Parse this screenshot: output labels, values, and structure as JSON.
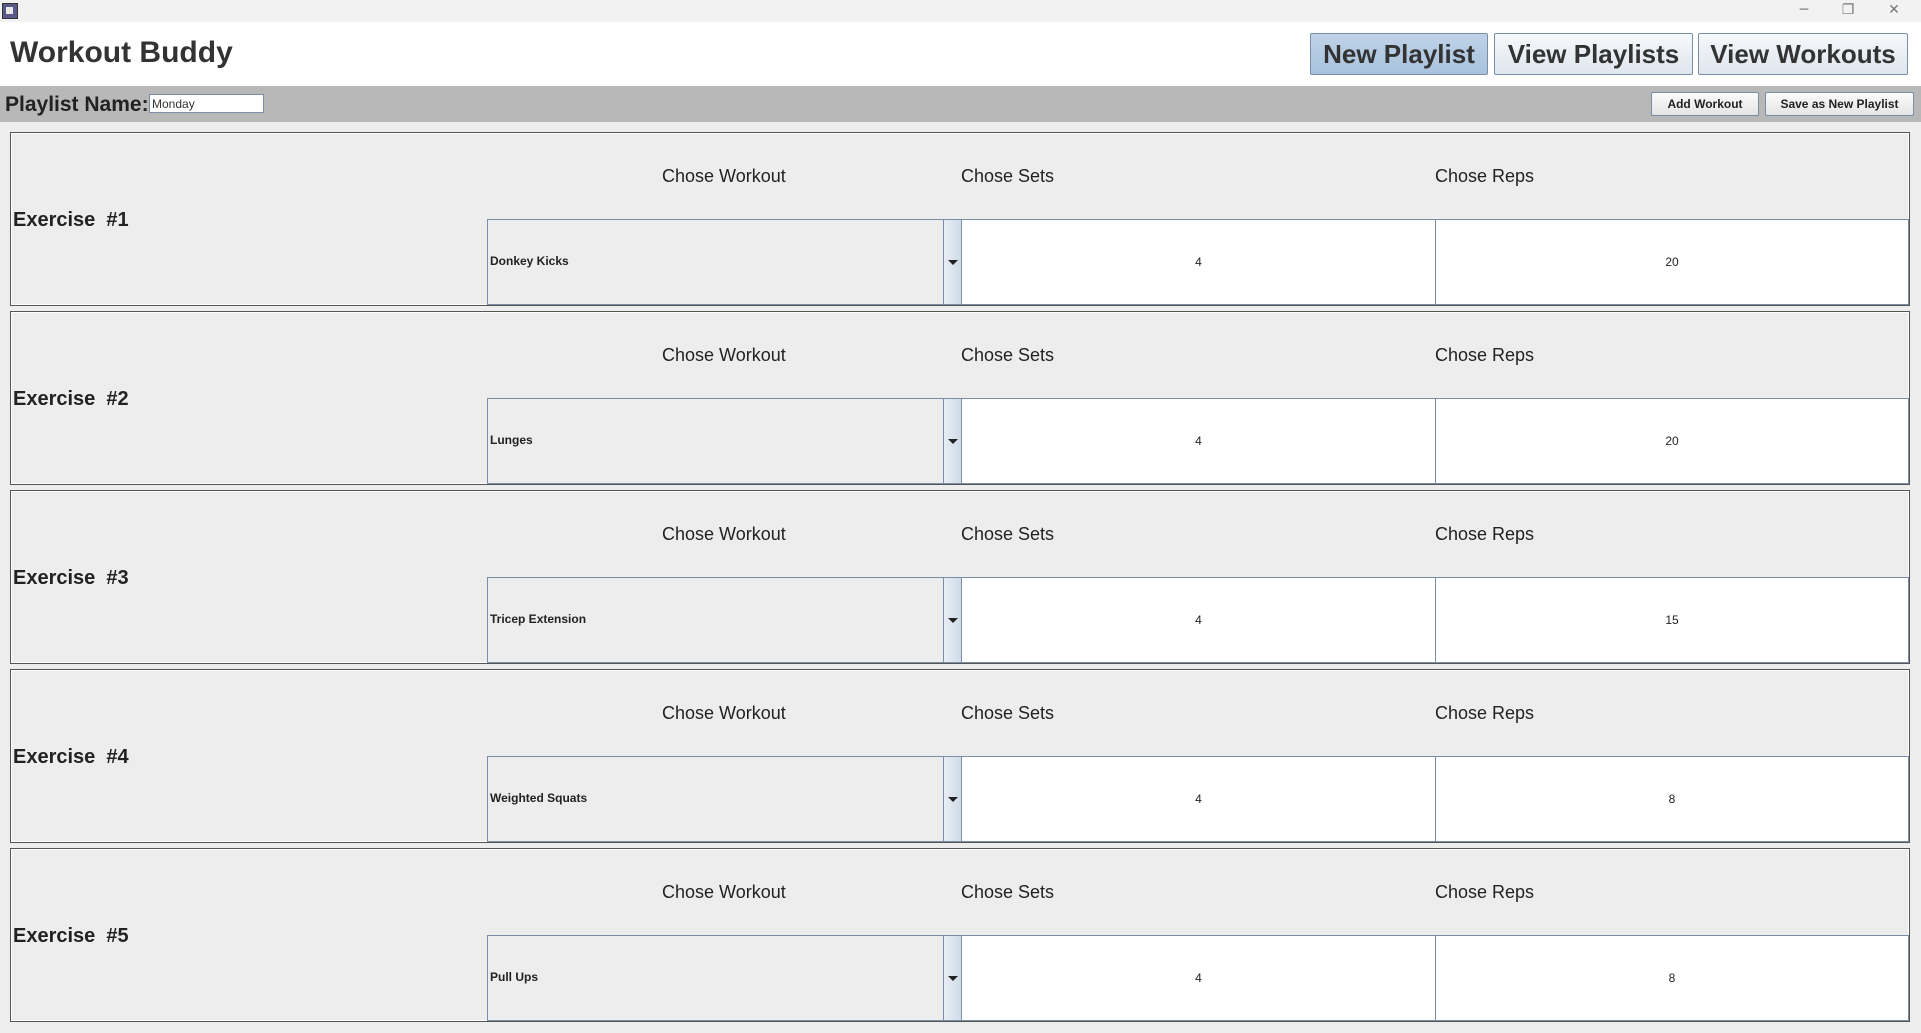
{
  "window": {
    "icon": "java-cup-icon",
    "controls": {
      "minimize": "─",
      "maximize": "❐",
      "close": "✕"
    }
  },
  "header": {
    "title": "Workout Buddy",
    "nav": {
      "new_playlist": "New Playlist",
      "view_playlists": "View Playlists",
      "view_workouts": "View Workouts"
    },
    "active_nav": "new_playlist"
  },
  "toolbar": {
    "playlist_label": "Playlist Name:",
    "playlist_value": "Monday",
    "add_workout": "Add Workout",
    "save_new": "Save as New Playlist"
  },
  "column_headers": {
    "workout": "Chose Workout",
    "sets": "Chose Sets",
    "reps": "Chose Reps"
  },
  "exercises": [
    {
      "label": "Exercise  #1",
      "workout": "Donkey Kicks",
      "sets": "4",
      "reps": "20"
    },
    {
      "label": "Exercise  #2",
      "workout": "Lunges",
      "sets": "4",
      "reps": "20"
    },
    {
      "label": "Exercise  #3",
      "workout": "Tricep Extension",
      "sets": "4",
      "reps": "15"
    },
    {
      "label": "Exercise  #4",
      "workout": "Weighted Squats",
      "sets": "4",
      "reps": "8"
    },
    {
      "label": "Exercise  #5",
      "workout": "Pull Ups",
      "sets": "4",
      "reps": "8"
    }
  ],
  "colors": {
    "header_bg": "#ffffff",
    "toolbar_bg": "#b8b8b8",
    "active_button": "#b5cbe3",
    "border": "#7a8ea8"
  }
}
